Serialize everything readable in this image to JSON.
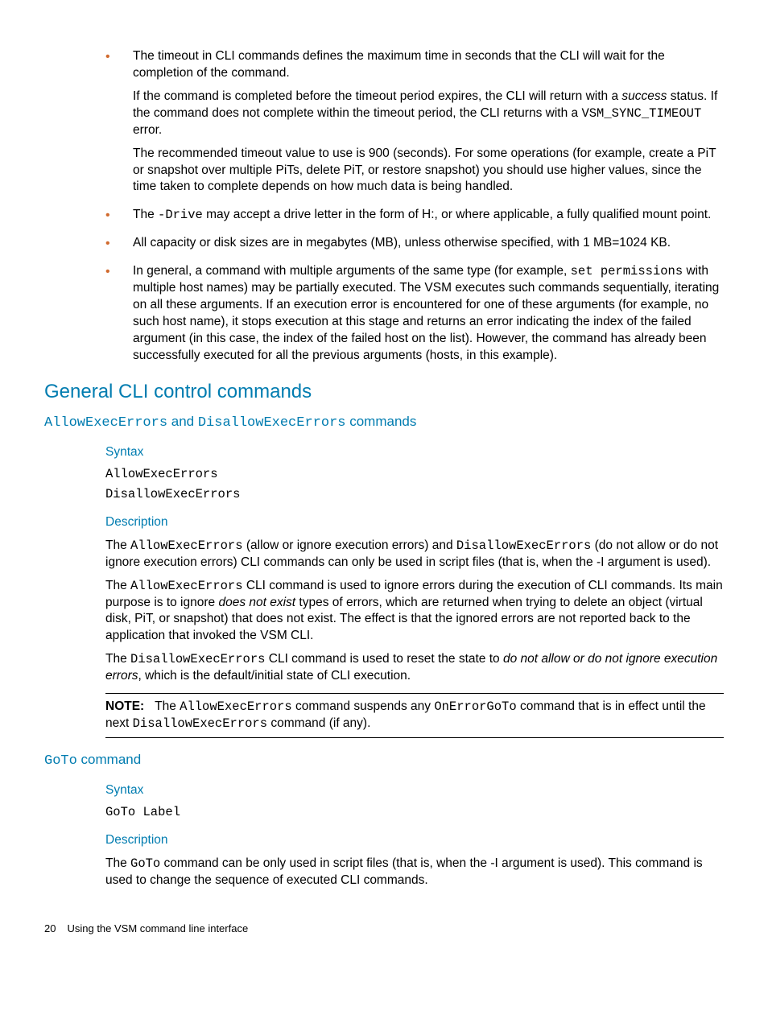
{
  "bullets": {
    "b1": {
      "p1a": "The timeout in CLI commands defines the maximum time in seconds that the CLI will wait for the completion of the command.",
      "p2a": "If the command is completed before the timeout period expires, the CLI will return with a ",
      "p2_italic": "success",
      "p2b": " status. If the command does not complete within the timeout period, the CLI returns with a ",
      "p2_mono": "VSM_SYNC_TIMEOUT",
      "p2c": " error.",
      "p3": "The recommended timeout value to use is 900 (seconds). For some operations (for example, create a PiT or snapshot over multiple PiTs, delete PiT, or restore snapshot) you should use higher values, since the time taken to complete depends on how much data is being handled."
    },
    "b2": {
      "a": "The ",
      "mono": "-Drive",
      "b": " may accept a drive letter in the form of H:, or where applicable, a fully qualified mount point."
    },
    "b3": "All capacity or disk sizes are in megabytes (MB), unless otherwise specified, with 1 MB=1024 KB.",
    "b4": {
      "a": "In general, a command with multiple arguments of the same type (for example, ",
      "mono": "set permissions",
      "b": " with multiple host names) may be partially executed. The VSM executes such commands sequentially, iterating on all these arguments. If an execution error is encountered for one of these arguments (for example, no such host name), it stops execution at this stage and returns an error indicating the index of the failed argument (in this case, the index of the failed host on the list). However, the command has already been successfully executed for all the previous arguments (hosts, in this example)."
    }
  },
  "section_heading": "General CLI control commands",
  "allow_disallow": {
    "h_mono1": "AllowExecErrors",
    "h_and": " and ",
    "h_mono2": "DisallowExecErrors",
    "h_suffix": " commands",
    "syntax_label": "Syntax",
    "syntax_line1": "AllowExecErrors",
    "syntax_line2": "DisallowExecErrors",
    "desc_label": "Description",
    "p1": {
      "a": "The ",
      "m1": "AllowExecErrors",
      "b": " (allow or ignore execution errors) and ",
      "m2": "DisallowExecErrors",
      "c": " (do not allow or do not ignore execution errors) CLI commands can only be used in script files (that is, when the -I argument is used)."
    },
    "p2": {
      "a": "The ",
      "m1": "AllowExecErrors",
      "b": " CLI command is used to ignore errors during the execution of CLI commands. Its main purpose is to ignore ",
      "i1": "does not exist",
      "c": " types of errors, which are returned when trying to delete an object (virtual disk, PiT, or snapshot) that does not exist. The effect is that the ignored errors are not reported back to the application that invoked the VSM CLI."
    },
    "p3": {
      "a": "The ",
      "m1": "DisallowExecErrors",
      "b": " CLI command is used to reset the state to ",
      "i1": "do not allow or do not ignore execution errors",
      "c": ", which is the default/initial state of CLI execution."
    },
    "note": {
      "label": "NOTE:",
      "a": "The ",
      "m1": "AllowExecErrors",
      "b": " command suspends any ",
      "m2": "OnErrorGoTo",
      "c": " command that is in effect until the next ",
      "m3": "DisallowExecErrors",
      "d": " command (if any)."
    }
  },
  "goto": {
    "h_mono": "GoTo",
    "h_suffix": " command",
    "syntax_label": "Syntax",
    "syntax_line": "GoTo Label",
    "desc_label": "Description",
    "p1": {
      "a": "The ",
      "m1": "GoTo",
      "b": " command can be only used in script files (that is, when the -I argument is used). This command is used to change the sequence of executed CLI commands."
    }
  },
  "footer": {
    "page": "20",
    "title": "Using the VSM command line interface"
  }
}
